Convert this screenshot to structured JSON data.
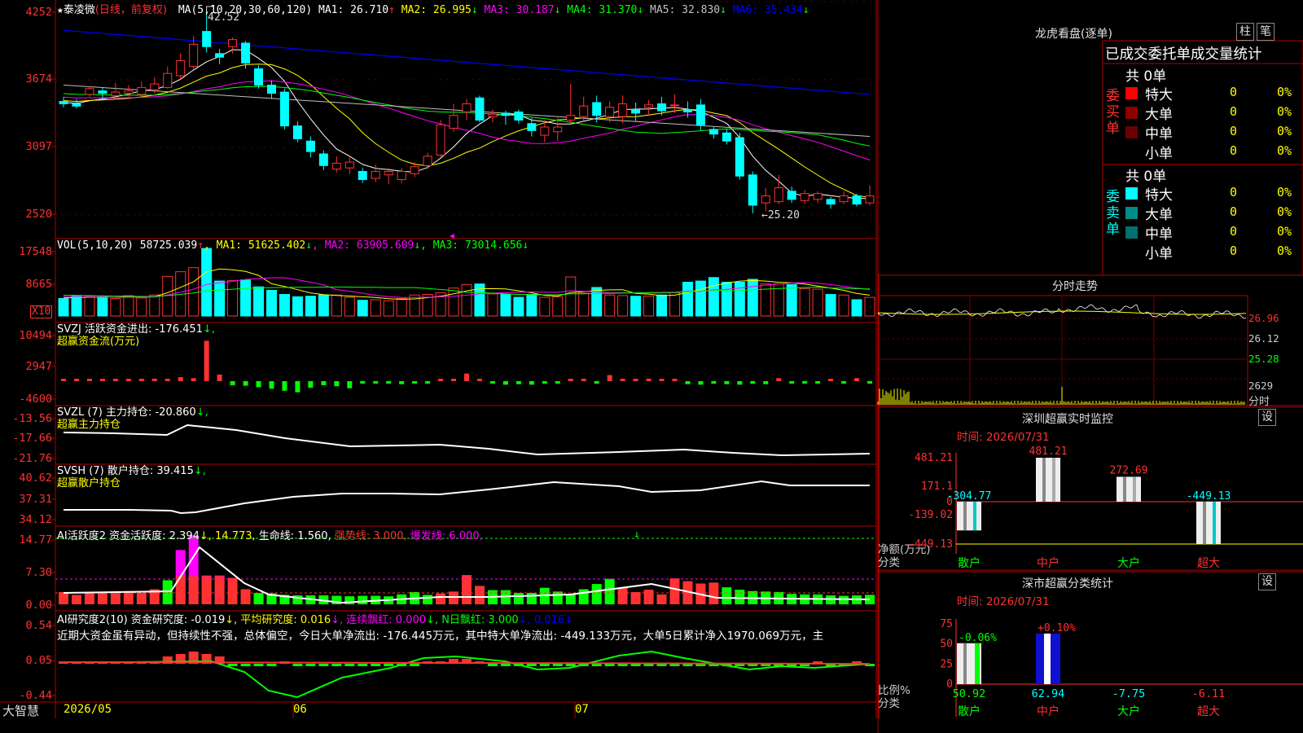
{
  "colors": {
    "up": "#ff3232",
    "down": "#00ffff",
    "ma1": "#ffffff",
    "ma2": "#ffff00",
    "ma3": "#ff00ff",
    "ma4": "#00ff00",
    "ma5": "#c0c0c0",
    "ma6": "#0000ff",
    "border": "#b00000",
    "white": "#ffffff",
    "yellow": "#ffff00",
    "green": "#00ff00",
    "magenta": "#ff00ff",
    "red": "#ff3232",
    "cyan": "#00ffff"
  },
  "main": {
    "title_star": "★",
    "stock_name": "泰凌微",
    "period": "(日线，前复权)",
    "ma_header": "MA(5,10,20,30,60,120)",
    "ma_values": [
      {
        "key": "ma1",
        "label": "MA1: 26.710",
        "arrow": "↑"
      },
      {
        "key": "ma2",
        "label": "MA2: 26.995",
        "arrow": "↓"
      },
      {
        "key": "ma3",
        "label": "MA3: 30.187",
        "arrow": "↓"
      },
      {
        "key": "ma4",
        "label": "MA4: 31.370",
        "arrow": "↓"
      },
      {
        "key": "ma5",
        "label": "MA5: 32.830",
        "arrow": "↓"
      },
      {
        "key": "ma6",
        "label": "MA6: 35.434",
        "arrow": "↓"
      }
    ],
    "high_label": "42.52",
    "low_label": "←25.20",
    "y_ticks": [
      "4252",
      "3674",
      "3097",
      "2520"
    ],
    "scale_label": "X10"
  },
  "vol": {
    "header": "VOL(5,10,20)",
    "value": "58725.039",
    "value_arrow": "↑",
    "ma": [
      {
        "label": "MA1: 51625.402",
        "arrow": "↓"
      },
      {
        "label": "MA2: 63905.609",
        "arrow": "↓"
      },
      {
        "label": "MA3: 73014.656",
        "arrow": "↓"
      }
    ],
    "y_ticks": [
      "17548",
      "8665"
    ]
  },
  "svzj": {
    "line1": "SVZJ  活跃资金进出: -176.451",
    "arrow": "↓,",
    "line2": "超赢资金流(万元)",
    "y_ticks": [
      "10494",
      "2947",
      "-4600"
    ]
  },
  "svzl": {
    "line1": "SVZL (7) 主力持仓: -20.860",
    "arrow": "↓,",
    "line2": "超赢主力持仓",
    "y_ticks": [
      "-13.56",
      "-17.66",
      "-21.76"
    ]
  },
  "svsh": {
    "line1": "SVSH (7) 散户持仓: 39.415",
    "arrow": "↓,",
    "line2": "超赢散户持仓",
    "y_ticks": [
      "40.62",
      "37.31",
      "34.12"
    ]
  },
  "ai1": {
    "parts": [
      {
        "t": "AI活跃度2 资金活跃度: 2.394",
        "c": "#ffffff"
      },
      {
        "t": "↓, 14.773,",
        "c": "#ffff00"
      },
      {
        "t": " 生命线: 1.560,",
        "c": "#ffffff"
      },
      {
        "t": " 强势线: 3.000,",
        "c": "#ff3232"
      },
      {
        "t": " 爆发线: 6.000,",
        "c": "#ff00ff"
      }
    ],
    "y_ticks": [
      "14.77",
      "7.30",
      "0.00"
    ]
  },
  "ai2": {
    "parts": [
      {
        "t": "AI研究度2(10) 资金研究度: -0.019",
        "c": "#ffffff"
      },
      {
        "t": "↓, 平均研究度: 0.016",
        "c": "#ffff00"
      },
      {
        "t": "↓, 连续飘红: 0.000",
        "c": "#ff00ff"
      },
      {
        "t": "↓, N日飘红: 3.000",
        "c": "#00ff00"
      },
      {
        "t": "↓, 0.016↓",
        "c": "#0000ff"
      }
    ],
    "comment": "近期大资金虽有异动，但持续性不强，总体偏空，今日大单净流出: -176.445万元，其中特大单净流出: -449.133万元，大单5日累计净入1970.069万元，主",
    "y_ticks": [
      "0.54",
      "0.05",
      "-0.44"
    ]
  },
  "bottom": {
    "brand": "大智慧",
    "dates": [
      "2026/05",
      "06",
      "07"
    ]
  },
  "dragon": {
    "title": "龙虎看盘(逐单)",
    "btn1": "柱",
    "btn2": "笔",
    "header": "已成交委托单成交量统计",
    "buy_label": "委买单",
    "sell_label": "委卖单",
    "buy_total": "共 0单",
    "sell_total": "共 0单",
    "buy_rows": [
      {
        "name": "特大",
        "count": "0",
        "pct": "0%",
        "color": "#ff0000"
      },
      {
        "name": "大单",
        "count": "0",
        "pct": "0%",
        "color": "#8b0000"
      },
      {
        "name": "中单",
        "count": "0",
        "pct": "0%",
        "color": "#6b0000"
      },
      {
        "name": "小单",
        "count": "0",
        "pct": "0%",
        "color": ""
      }
    ],
    "sell_rows": [
      {
        "name": "特大",
        "count": "0",
        "pct": "0%",
        "color": "#00ffff"
      },
      {
        "name": "大单",
        "count": "0",
        "pct": "0%",
        "color": "#008b8b"
      },
      {
        "name": "中单",
        "count": "0",
        "pct": "0%",
        "color": "#007070"
      },
      {
        "name": "小单",
        "count": "0",
        "pct": "0%",
        "color": ""
      }
    ]
  },
  "intraday": {
    "title": "分时走势",
    "ticks": [
      "26.96",
      "26.12",
      "25.28",
      "2629"
    ],
    "vol_label": "分时"
  },
  "sz_monitor": {
    "title": "深圳超赢实时监控",
    "btn": "设",
    "time": "时间: 2026/07/31",
    "y_ticks": [
      "481.21",
      "171.1",
      "0",
      "-139.02",
      "-449.13"
    ],
    "bars": [
      {
        "cat": "散户",
        "value": -304.77,
        "label": "-304.77",
        "lc": "#00ffff"
      },
      {
        "cat": "中户",
        "value": 481.21,
        "label": "481.21",
        "lc": "#ff3232"
      },
      {
        "cat": "大户",
        "value": 272.69,
        "label": "272.69",
        "lc": "#ff3232"
      },
      {
        "cat": "超大",
        "value": -449.13,
        "label": "-449.13",
        "lc": "#00ffff"
      }
    ],
    "unit": "净额(万元)",
    "cat_label": "分类"
  },
  "sh_stats": {
    "title": "深市超赢分类统计",
    "btn": "设",
    "time": "时间: 2026/07/31",
    "y_ticks": [
      "75",
      "50",
      "25",
      "0"
    ],
    "bars": [
      {
        "cat": "散户",
        "value": 50.92,
        "top": "-0.06%",
        "tc": "#00ff00",
        "bottom": "50.92",
        "bc": "#00ff00"
      },
      {
        "cat": "中户",
        "value": 62.94,
        "top": "+0.10%",
        "tc": "#ff3232",
        "bottom": "62.94",
        "bc": "#00ffff"
      },
      {
        "cat": "大户",
        "value": -7.75,
        "top": "",
        "tc": "",
        "bottom": "-7.75",
        "bc": "#00ffff"
      },
      {
        "cat": "超大",
        "value": -6.11,
        "top": "",
        "tc": "",
        "bottom": "-6.11",
        "bc": "#ff3232"
      }
    ],
    "unit": "比例%",
    "cat_label": "分类"
  },
  "chart_data": {
    "type": "candlestick",
    "candles": [
      [
        34.8,
        34.6,
        35.2,
        34.3
      ],
      [
        34.6,
        34.4,
        35.0,
        34.2
      ],
      [
        35.4,
        35.9,
        36.1,
        35.2
      ],
      [
        35.7,
        35.5,
        36.0,
        34.9
      ],
      [
        35.3,
        35.6,
        36.4,
        35.0
      ],
      [
        35.5,
        35.7,
        36.2,
        35.2
      ],
      [
        35.4,
        36.0,
        36.5,
        35.2
      ],
      [
        35.8,
        36.3,
        36.9,
        35.5
      ],
      [
        36.0,
        37.2,
        37.8,
        35.9
      ],
      [
        37.0,
        38.3,
        38.9,
        36.7
      ],
      [
        37.8,
        39.7,
        40.4,
        37.6
      ],
      [
        40.8,
        39.5,
        42.5,
        39.0
      ],
      [
        38.9,
        38.6,
        39.3,
        38.0
      ],
      [
        39.5,
        40.1,
        40.3,
        38.9
      ],
      [
        39.8,
        38.1,
        40.0,
        37.6
      ],
      [
        37.6,
        36.2,
        37.9,
        35.9
      ],
      [
        36.2,
        35.5,
        36.6,
        35.0
      ],
      [
        35.6,
        32.7,
        35.9,
        32.4
      ],
      [
        32.7,
        31.6,
        33.1,
        31.3
      ],
      [
        31.4,
        30.5,
        31.8,
        30.0
      ],
      [
        30.3,
        29.3,
        30.6,
        28.9
      ],
      [
        29.0,
        29.5,
        30.1,
        28.7
      ],
      [
        29.1,
        29.6,
        30.2,
        28.6
      ],
      [
        28.8,
        28.1,
        29.1,
        27.8
      ],
      [
        28.2,
        28.8,
        29.4,
        27.9
      ],
      [
        28.5,
        28.8,
        29.1,
        27.7
      ],
      [
        28.1,
        28.8,
        29.1,
        27.8
      ],
      [
        28.6,
        29.2,
        29.6,
        28.3
      ],
      [
        29.3,
        30.1,
        30.4,
        29.0
      ],
      [
        30.2,
        32.8,
        33.2,
        30.0
      ],
      [
        32.5,
        33.6,
        34.6,
        32.2
      ],
      [
        33.9,
        34.6,
        35.0,
        33.2
      ],
      [
        35.1,
        33.2,
        35.3,
        33.0
      ],
      [
        33.5,
        33.7,
        34.1,
        33.0
      ],
      [
        33.8,
        33.6,
        34.0,
        32.8
      ],
      [
        33.9,
        33.2,
        34.1,
        32.9
      ],
      [
        32.9,
        32.3,
        33.4,
        31.8
      ],
      [
        31.9,
        32.6,
        33.2,
        31.3
      ],
      [
        32.2,
        32.6,
        33.4,
        31.4
      ],
      [
        33.2,
        33.6,
        36.3,
        32.9
      ],
      [
        33.5,
        34.4,
        35.2,
        33.1
      ],
      [
        34.7,
        33.6,
        35.3,
        33.0
      ],
      [
        33.5,
        34.3,
        34.8,
        33.0
      ],
      [
        33.5,
        34.6,
        35.3,
        32.9
      ],
      [
        34.1,
        33.8,
        34.7,
        33.1
      ],
      [
        34.3,
        34.5,
        34.9,
        33.6
      ],
      [
        34.6,
        34.0,
        35.2,
        33.6
      ],
      [
        34.5,
        34.5,
        35.4,
        33.8
      ],
      [
        34.1,
        33.9,
        34.8,
        33.4
      ],
      [
        34.5,
        32.8,
        35.0,
        32.3
      ],
      [
        32.4,
        32.0,
        32.6,
        31.6
      ],
      [
        32.1,
        31.4,
        32.4,
        31.1
      ],
      [
        31.7,
        28.4,
        32.1,
        28.1
      ],
      [
        28.5,
        25.9,
        28.8,
        25.2
      ],
      [
        26.1,
        26.7,
        27.4,
        25.4
      ],
      [
        26.2,
        27.4,
        28.5,
        26.0
      ],
      [
        27.1,
        26.4,
        27.5,
        26.1
      ],
      [
        26.3,
        26.9,
        27.2,
        26.0
      ],
      [
        26.4,
        26.9,
        27.1,
        26.1
      ],
      [
        26.4,
        26.0,
        26.6,
        25.6
      ],
      [
        26.2,
        26.7,
        27.1,
        26.0
      ],
      [
        26.7,
        26.0,
        26.9,
        25.8
      ],
      [
        26.1,
        26.7,
        27.6,
        25.9
      ]
    ],
    "volume": [
      3.0,
      3.4,
      3.4,
      3.3,
      3.0,
      3.5,
      3.1,
      3.6,
      6.8,
      7.6,
      8.3,
      11.6,
      6.0,
      6.1,
      6.2,
      5.0,
      4.4,
      3.7,
      3.3,
      3.4,
      3.6,
      3.6,
      3.2,
      2.7,
      2.8,
      2.6,
      3.0,
      3.6,
      3.7,
      4.0,
      4.8,
      5.4,
      5.5,
      3.8,
      3.7,
      3.2,
      3.7,
      3.2,
      3.3,
      6.7,
      3.9,
      4.9,
      3.6,
      3.5,
      3.4,
      3.4,
      3.6,
      4.0,
      5.8,
      6.0,
      6.6,
      5.8,
      5.8,
      6.3,
      5.5,
      5.5,
      5.4,
      4.7,
      4.6,
      3.7,
      3.6,
      2.8,
      3.2
    ],
    "dates": [
      "2026/05",
      "06",
      "07"
    ]
  }
}
